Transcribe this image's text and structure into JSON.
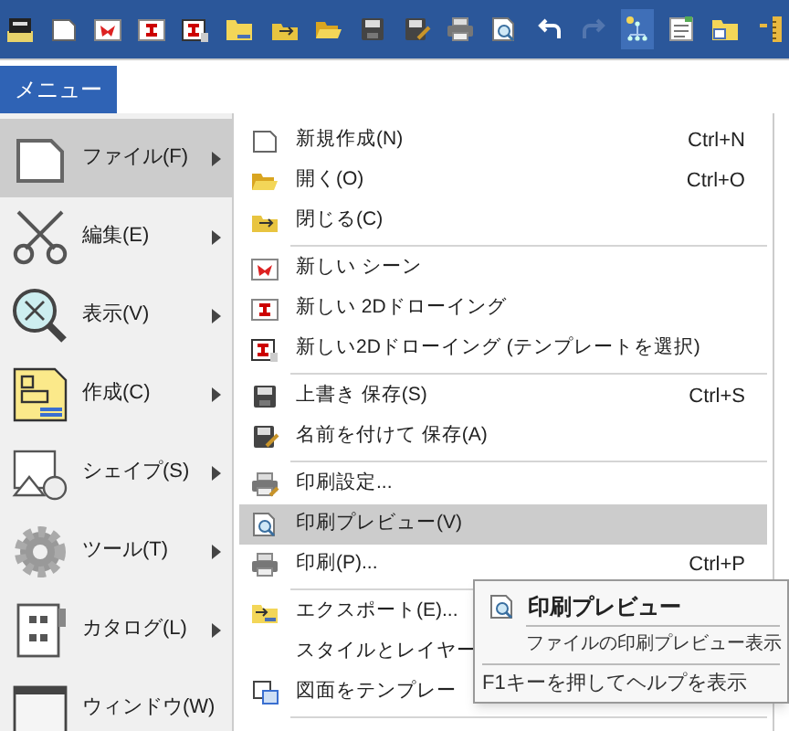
{
  "toolbar": [
    {
      "kind": "app",
      "disabled": false,
      "selected": false
    },
    {
      "kind": "page",
      "disabled": false,
      "selected": false
    },
    {
      "kind": "scene",
      "disabled": false,
      "selected": false
    },
    {
      "kind": "drawing",
      "disabled": false,
      "selected": false
    },
    {
      "kind": "drawing-template",
      "disabled": false,
      "selected": false
    },
    {
      "kind": "folder-new",
      "disabled": false,
      "selected": false
    },
    {
      "kind": "folder-arrow",
      "disabled": false,
      "selected": false
    },
    {
      "kind": "folder-open",
      "disabled": false,
      "selected": false
    },
    {
      "kind": "save",
      "disabled": false,
      "selected": false
    },
    {
      "kind": "save-as",
      "disabled": false,
      "selected": false
    },
    {
      "kind": "print",
      "disabled": false,
      "selected": false
    },
    {
      "kind": "preview",
      "disabled": false,
      "selected": false
    },
    {
      "kind": "undo",
      "disabled": false,
      "selected": false
    },
    {
      "kind": "redo",
      "disabled": true,
      "selected": false
    },
    {
      "kind": "tree",
      "disabled": false,
      "selected": true
    },
    {
      "kind": "notes",
      "disabled": false,
      "selected": false
    },
    {
      "kind": "folder-window",
      "disabled": false,
      "selected": false
    },
    {
      "kind": "ruler",
      "disabled": false,
      "selected": false
    }
  ],
  "menu_tab": {
    "label": "メニュー"
  },
  "categories": [
    {
      "kind": "page",
      "label": "ファイル(F)",
      "selected": true
    },
    {
      "kind": "scissors",
      "label": "編集(E)",
      "selected": false
    },
    {
      "kind": "zoom",
      "label": "表示(V)",
      "selected": false
    },
    {
      "kind": "create",
      "label": "作成(C)",
      "selected": false
    },
    {
      "kind": "shape",
      "label": "シェイプ(S)",
      "selected": false
    },
    {
      "kind": "gear",
      "label": "ツール(T)",
      "selected": false
    },
    {
      "kind": "catalog",
      "label": "カタログ(L)",
      "selected": false
    },
    {
      "kind": "window",
      "label": "ウィンドウ(W)",
      "selected": false
    }
  ],
  "submenu": [
    {
      "kind": "page",
      "label": "新規作成(N)",
      "shortcut": "Ctrl+N",
      "selected": false
    },
    {
      "kind": "folder-open",
      "label": "開く(O)",
      "shortcut": "Ctrl+O",
      "selected": false
    },
    {
      "kind": "folder-arrow",
      "label": "閉じる(C)",
      "selected": false
    },
    {
      "kind": "separator"
    },
    {
      "kind": "scene",
      "label": "新しい シーン",
      "selected": false
    },
    {
      "kind": "drawing",
      "label": "新しい 2Dドローイング",
      "selected": false
    },
    {
      "kind": "drawing-template",
      "label": "新しい2Dドローイング (テンプレートを選択)",
      "selected": false
    },
    {
      "kind": "separator"
    },
    {
      "kind": "save",
      "label": "上書き 保存(S)",
      "shortcut": "Ctrl+S",
      "selected": false
    },
    {
      "kind": "save-as",
      "label": "名前を付けて 保存(A)",
      "selected": false
    },
    {
      "kind": "separator"
    },
    {
      "kind": "print-settings",
      "label": "印刷設定...",
      "selected": false
    },
    {
      "kind": "preview",
      "label": "印刷プレビュー(V)",
      "selected": true
    },
    {
      "kind": "print",
      "label": "印刷(P)...",
      "shortcut": "Ctrl+P",
      "selected": false
    },
    {
      "kind": "separator"
    },
    {
      "kind": "export",
      "label": "エクスポート(E)...",
      "selected": false
    },
    {
      "kind": "plain",
      "label": "スタイルとレイヤー",
      "selected": false
    },
    {
      "kind": "template",
      "label": "図面をテンプレー",
      "selected": false
    },
    {
      "kind": "separator"
    }
  ],
  "tooltip": {
    "title": "印刷プレビュー",
    "description": "ファイルの印刷プレビュー表示",
    "help": "F1キーを押してヘルプを表示"
  }
}
